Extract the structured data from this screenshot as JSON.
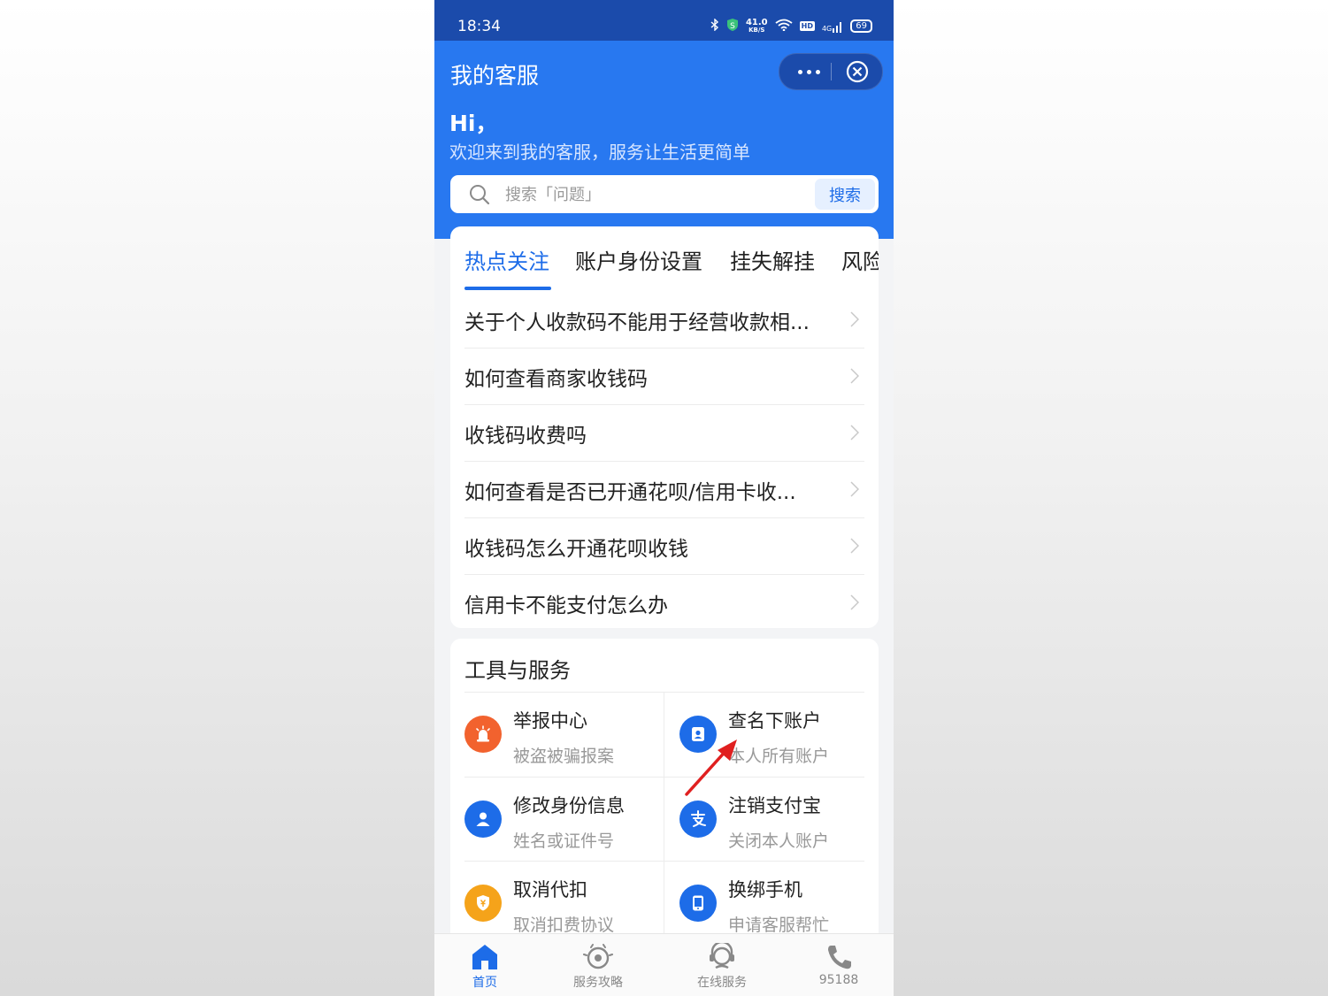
{
  "status_bar": {
    "time": "18:34",
    "net_speed": "41.0",
    "net_unit": "KB/S",
    "hd": "HD",
    "signal": "4G",
    "battery": "69"
  },
  "header": {
    "title": "我的客服",
    "greeting": "Hi，",
    "subtitle": "欢迎来到我的客服，服务让生活更简单"
  },
  "search": {
    "placeholder": "搜索「问题」",
    "button_label": "搜索"
  },
  "tabs": [
    {
      "label": "热点关注",
      "active": true
    },
    {
      "label": "账户身份设置"
    },
    {
      "label": "挂失解挂"
    },
    {
      "label": "风险"
    }
  ],
  "faq": [
    "关于个人收款码不能用于经营收款相...",
    "如何查看商家收钱码",
    "收钱码收费吗",
    "如何查看是否已开通花呗/信用卡收...",
    "收钱码怎么开通花呗收钱",
    "信用卡不能支付怎么办"
  ],
  "tools": {
    "title": "工具与服务",
    "items": [
      {
        "title": "举报中心",
        "subtitle": "被盗被骗报案",
        "icon": "alarm-icon",
        "color": "#f2622e"
      },
      {
        "title": "查名下账户",
        "subtitle": "本人所有账户",
        "icon": "contact-book-icon",
        "color": "#1d6ce8"
      },
      {
        "title": "修改身份信息",
        "subtitle": "姓名或证件号",
        "icon": "person-icon",
        "color": "#1d6ce8"
      },
      {
        "title": "注销支付宝",
        "subtitle": "关闭本人账户",
        "icon": "alipay-icon",
        "color": "#1d6ce8"
      },
      {
        "title": "取消代扣",
        "subtitle": "取消扣费协议",
        "icon": "shield-yuan-icon",
        "color": "#f5a31a"
      },
      {
        "title": "换绑手机",
        "subtitle": "申请客服帮忙",
        "icon": "phone-device-icon",
        "color": "#1d6ce8"
      }
    ]
  },
  "tabbar": [
    {
      "label": "首页",
      "icon": "home-icon",
      "active": true
    },
    {
      "label": "服务攻略",
      "icon": "guide-icon"
    },
    {
      "label": "在线服务",
      "icon": "headset-icon"
    },
    {
      "label": "95188",
      "icon": "phone-icon"
    }
  ],
  "colors": {
    "status_bar": "#1b4bab",
    "header": "#2878f0",
    "accent": "#1d6ce8",
    "annotation_arrow": "#e02020"
  }
}
